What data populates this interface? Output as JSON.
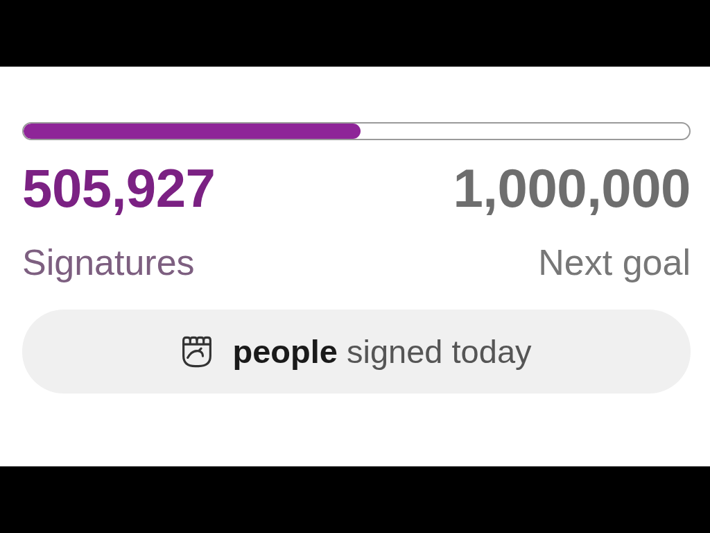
{
  "progress": {
    "level": 0.506
  },
  "signatures": {
    "count": "505,927",
    "label": "Signatures"
  },
  "goal": {
    "count": "1,000,000",
    "label": "Next goal"
  },
  "today": {
    "text": "**people** signed today"
  }
}
